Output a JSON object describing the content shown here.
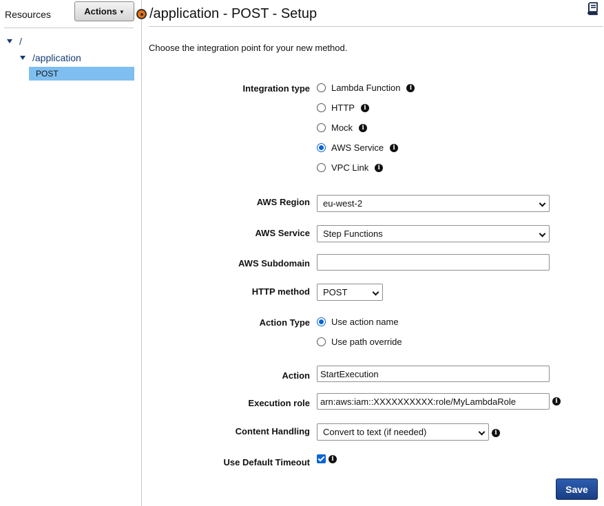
{
  "resources": {
    "title": "Resources",
    "actions_label": "Actions",
    "tree": [
      {
        "label": "/",
        "expanded": true
      },
      {
        "label": "/application",
        "expanded": true
      },
      {
        "label": "POST",
        "selected": true
      }
    ]
  },
  "page": {
    "title": "/application - POST - Setup",
    "intro": "Choose the integration point for your new method."
  },
  "form": {
    "integration_type": {
      "label": "Integration type",
      "options": [
        {
          "label": "Lambda Function",
          "checked": false
        },
        {
          "label": "HTTP",
          "checked": false
        },
        {
          "label": "Mock",
          "checked": false
        },
        {
          "label": "AWS Service",
          "checked": true
        },
        {
          "label": "VPC Link",
          "checked": false
        }
      ]
    },
    "aws_region": {
      "label": "AWS Region",
      "value": "eu-west-2"
    },
    "aws_service": {
      "label": "AWS Service",
      "value": "Step Functions"
    },
    "aws_subdomain": {
      "label": "AWS Subdomain",
      "value": ""
    },
    "http_method": {
      "label": "HTTP method",
      "value": "POST"
    },
    "action_type": {
      "label": "Action Type",
      "options": [
        {
          "label": "Use action name",
          "checked": true
        },
        {
          "label": "Use path override",
          "checked": false
        }
      ]
    },
    "action": {
      "label": "Action",
      "value": "StartExecution"
    },
    "execution_role": {
      "label": "Execution role",
      "value": "arn:aws:iam::XXXXXXXXXX:role/MyLambdaRole"
    },
    "content_handling": {
      "label": "Content Handling",
      "value": "Convert to text (if needed)"
    },
    "use_default_timeout": {
      "label": "Use Default Timeout",
      "checked": true
    },
    "save_label": "Save"
  },
  "colors": {
    "accent_blue": "#0a64d8",
    "selected_tree_bg": "#7fbef1",
    "tree_text": "#163c72",
    "save_button": "#1f4a9a",
    "handle_orange": "#ec7211"
  },
  "icons": {
    "info": "info-icon",
    "book": "book-icon",
    "tree_toggle": "caret-down-icon"
  }
}
